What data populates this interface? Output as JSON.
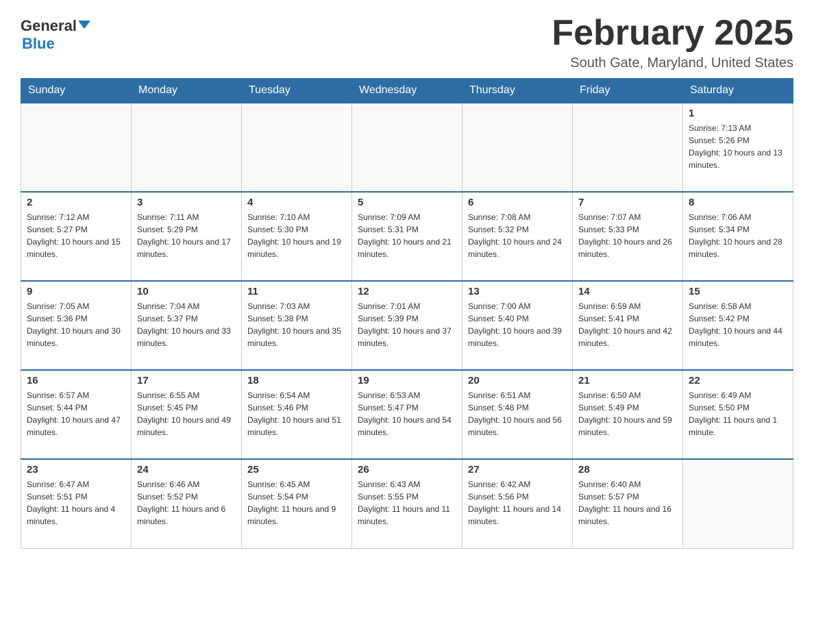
{
  "header": {
    "logo_text_general": "General",
    "logo_text_blue": "Blue",
    "title": "February 2025",
    "subtitle": "South Gate, Maryland, United States"
  },
  "days_of_week": [
    "Sunday",
    "Monday",
    "Tuesday",
    "Wednesday",
    "Thursday",
    "Friday",
    "Saturday"
  ],
  "weeks": [
    [
      {
        "day": "",
        "info": ""
      },
      {
        "day": "",
        "info": ""
      },
      {
        "day": "",
        "info": ""
      },
      {
        "day": "",
        "info": ""
      },
      {
        "day": "",
        "info": ""
      },
      {
        "day": "",
        "info": ""
      },
      {
        "day": "1",
        "info": "Sunrise: 7:13 AM\nSunset: 5:26 PM\nDaylight: 10 hours and 13 minutes."
      }
    ],
    [
      {
        "day": "2",
        "info": "Sunrise: 7:12 AM\nSunset: 5:27 PM\nDaylight: 10 hours and 15 minutes."
      },
      {
        "day": "3",
        "info": "Sunrise: 7:11 AM\nSunset: 5:29 PM\nDaylight: 10 hours and 17 minutes."
      },
      {
        "day": "4",
        "info": "Sunrise: 7:10 AM\nSunset: 5:30 PM\nDaylight: 10 hours and 19 minutes."
      },
      {
        "day": "5",
        "info": "Sunrise: 7:09 AM\nSunset: 5:31 PM\nDaylight: 10 hours and 21 minutes."
      },
      {
        "day": "6",
        "info": "Sunrise: 7:08 AM\nSunset: 5:32 PM\nDaylight: 10 hours and 24 minutes."
      },
      {
        "day": "7",
        "info": "Sunrise: 7:07 AM\nSunset: 5:33 PM\nDaylight: 10 hours and 26 minutes."
      },
      {
        "day": "8",
        "info": "Sunrise: 7:06 AM\nSunset: 5:34 PM\nDaylight: 10 hours and 28 minutes."
      }
    ],
    [
      {
        "day": "9",
        "info": "Sunrise: 7:05 AM\nSunset: 5:36 PM\nDaylight: 10 hours and 30 minutes."
      },
      {
        "day": "10",
        "info": "Sunrise: 7:04 AM\nSunset: 5:37 PM\nDaylight: 10 hours and 33 minutes."
      },
      {
        "day": "11",
        "info": "Sunrise: 7:03 AM\nSunset: 5:38 PM\nDaylight: 10 hours and 35 minutes."
      },
      {
        "day": "12",
        "info": "Sunrise: 7:01 AM\nSunset: 5:39 PM\nDaylight: 10 hours and 37 minutes."
      },
      {
        "day": "13",
        "info": "Sunrise: 7:00 AM\nSunset: 5:40 PM\nDaylight: 10 hours and 39 minutes."
      },
      {
        "day": "14",
        "info": "Sunrise: 6:59 AM\nSunset: 5:41 PM\nDaylight: 10 hours and 42 minutes."
      },
      {
        "day": "15",
        "info": "Sunrise: 6:58 AM\nSunset: 5:42 PM\nDaylight: 10 hours and 44 minutes."
      }
    ],
    [
      {
        "day": "16",
        "info": "Sunrise: 6:57 AM\nSunset: 5:44 PM\nDaylight: 10 hours and 47 minutes."
      },
      {
        "day": "17",
        "info": "Sunrise: 6:55 AM\nSunset: 5:45 PM\nDaylight: 10 hours and 49 minutes."
      },
      {
        "day": "18",
        "info": "Sunrise: 6:54 AM\nSunset: 5:46 PM\nDaylight: 10 hours and 51 minutes."
      },
      {
        "day": "19",
        "info": "Sunrise: 6:53 AM\nSunset: 5:47 PM\nDaylight: 10 hours and 54 minutes."
      },
      {
        "day": "20",
        "info": "Sunrise: 6:51 AM\nSunset: 5:48 PM\nDaylight: 10 hours and 56 minutes."
      },
      {
        "day": "21",
        "info": "Sunrise: 6:50 AM\nSunset: 5:49 PM\nDaylight: 10 hours and 59 minutes."
      },
      {
        "day": "22",
        "info": "Sunrise: 6:49 AM\nSunset: 5:50 PM\nDaylight: 11 hours and 1 minute."
      }
    ],
    [
      {
        "day": "23",
        "info": "Sunrise: 6:47 AM\nSunset: 5:51 PM\nDaylight: 11 hours and 4 minutes."
      },
      {
        "day": "24",
        "info": "Sunrise: 6:46 AM\nSunset: 5:52 PM\nDaylight: 11 hours and 6 minutes."
      },
      {
        "day": "25",
        "info": "Sunrise: 6:45 AM\nSunset: 5:54 PM\nDaylight: 11 hours and 9 minutes."
      },
      {
        "day": "26",
        "info": "Sunrise: 6:43 AM\nSunset: 5:55 PM\nDaylight: 11 hours and 11 minutes."
      },
      {
        "day": "27",
        "info": "Sunrise: 6:42 AM\nSunset: 5:56 PM\nDaylight: 11 hours and 14 minutes."
      },
      {
        "day": "28",
        "info": "Sunrise: 6:40 AM\nSunset: 5:57 PM\nDaylight: 11 hours and 16 minutes."
      },
      {
        "day": "",
        "info": ""
      }
    ]
  ]
}
